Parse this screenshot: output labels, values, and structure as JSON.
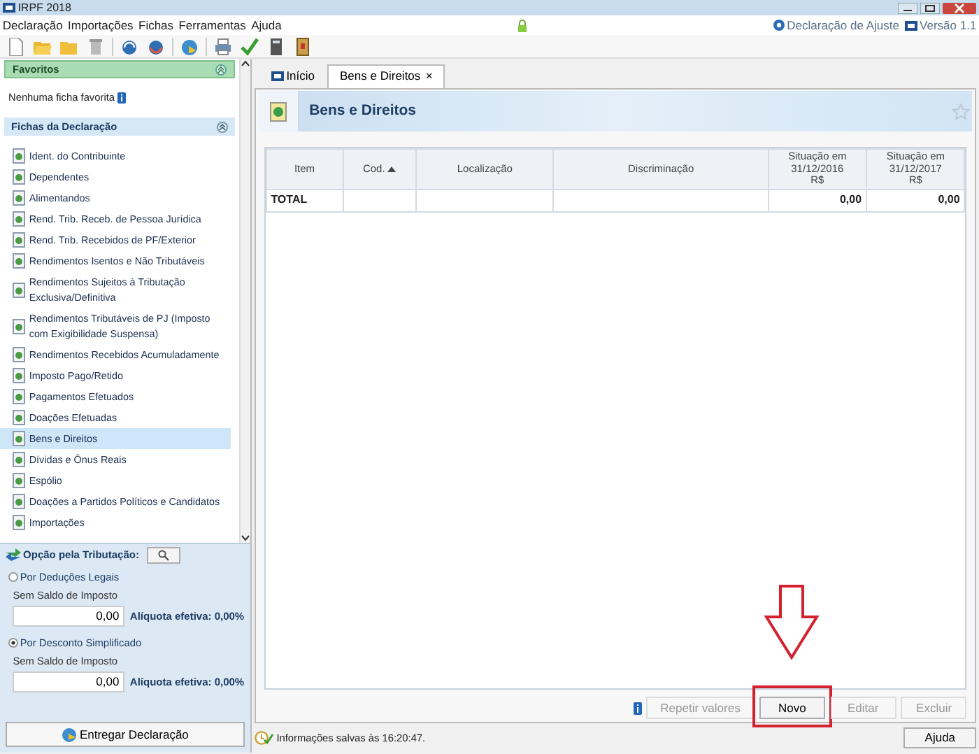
{
  "window": {
    "title": "IRPF 2018"
  },
  "menu": [
    {
      "label": "Declaração"
    },
    {
      "label": "Importações"
    },
    {
      "label": "Fichas"
    },
    {
      "label": "Ferramentas"
    },
    {
      "label": "Ajuda"
    }
  ],
  "header_info": [
    {
      "label": "Declaração de Ajuste"
    },
    {
      "label": "Versão 1.1"
    }
  ],
  "sidebar": {
    "favorites": {
      "title": "Favoritos",
      "empty_text": "Nenhuma ficha favorita"
    },
    "fichas": {
      "title": "Fichas da Declaração",
      "items": [
        {
          "label": "Ident. do Contribuinte",
          "selected": false
        },
        {
          "label": "Dependentes",
          "selected": false
        },
        {
          "label": "Alimentandos",
          "selected": false
        },
        {
          "label": "Rend. Trib. Receb. de Pessoa Jurídica",
          "selected": false
        },
        {
          "label": "Rend. Trib. Recebidos de PF/Exterior",
          "selected": false
        },
        {
          "label": "Rendimentos Isentos e Não Tributáveis",
          "selected": false
        },
        {
          "label": "Rendimentos Sujeitos à Tributação Exclusiva/Definitiva",
          "selected": false
        },
        {
          "label": "Rendimentos Tributáveis de PJ (Imposto com Exigibilidade Suspensa)",
          "selected": false
        },
        {
          "label": "Rendimentos Recebidos Acumuladamente",
          "selected": false
        },
        {
          "label": "Imposto Pago/Retido",
          "selected": false
        },
        {
          "label": "Pagamentos Efetuados",
          "selected": false
        },
        {
          "label": "Doações Efetuadas",
          "selected": false
        },
        {
          "label": "Bens e Direitos",
          "selected": true
        },
        {
          "label": "Dívidas e Ônus Reais",
          "selected": false
        },
        {
          "label": "Espólio",
          "selected": false
        },
        {
          "label": "Doações a Partidos Políticos e Candidatos",
          "selected": false
        },
        {
          "label": "Importações",
          "selected": false
        }
      ]
    }
  },
  "tributacao": {
    "label": "Opção pela Tributação:",
    "options": [
      {
        "label": "Por Deduções Legais",
        "selected": false,
        "caption": "Sem Saldo de Imposto",
        "value": "0,00",
        "rate": "Alíquota efetiva: 0,00%"
      },
      {
        "label": "Por Desconto Simplificado",
        "selected": true,
        "caption": "Sem Saldo de Imposto",
        "value": "0,00",
        "rate": "Alíquota efetiva: 0,00%"
      }
    ],
    "submit": "Entregar Declaração"
  },
  "tabs": [
    {
      "label": "Início",
      "selected": false
    },
    {
      "label": "Bens e Direitos",
      "selected": true,
      "close": "×"
    }
  ],
  "page": {
    "title": "Bens e Direitos"
  },
  "table": {
    "columns": [
      {
        "label": "Item"
      },
      {
        "label": "Cod.",
        "sorted": true
      },
      {
        "label": "Localização"
      },
      {
        "label": "Discriminação"
      },
      {
        "label": "Situação em\n31/12/2016\nR$"
      },
      {
        "label": "Situação em\n31/12/2017\nR$"
      }
    ],
    "total": {
      "label": "TOTAL",
      "values": [
        "0,00",
        "0,00"
      ]
    }
  },
  "buttons": [
    {
      "label": "Repetir valores",
      "disabled": true,
      "highlighted": false
    },
    {
      "label": "Novo",
      "disabled": false,
      "highlighted": true
    },
    {
      "label": "Editar",
      "disabled": true,
      "highlighted": false
    },
    {
      "label": "Excluir",
      "disabled": true,
      "highlighted": false
    }
  ],
  "status": {
    "message": "Informações salvas às 16:20:47.",
    "help": "Ajuda"
  }
}
